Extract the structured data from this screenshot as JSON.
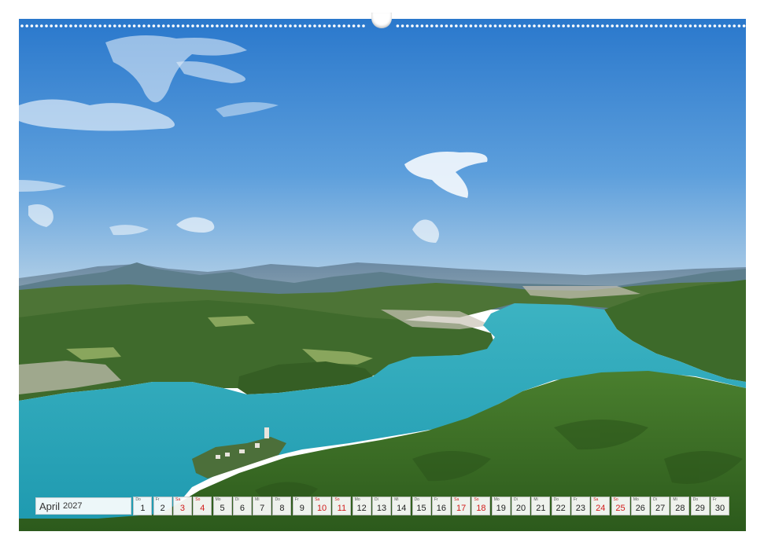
{
  "calendar": {
    "month": "April",
    "year": "2027",
    "days": [
      {
        "wd": "Do",
        "n": "1",
        "weekend": false
      },
      {
        "wd": "Fr",
        "n": "2",
        "weekend": false
      },
      {
        "wd": "Sa",
        "n": "3",
        "weekend": true
      },
      {
        "wd": "So",
        "n": "4",
        "weekend": true
      },
      {
        "wd": "Mo",
        "n": "5",
        "weekend": false
      },
      {
        "wd": "Di",
        "n": "6",
        "weekend": false
      },
      {
        "wd": "Mi",
        "n": "7",
        "weekend": false
      },
      {
        "wd": "Do",
        "n": "8",
        "weekend": false
      },
      {
        "wd": "Fr",
        "n": "9",
        "weekend": false
      },
      {
        "wd": "Sa",
        "n": "10",
        "weekend": true
      },
      {
        "wd": "So",
        "n": "11",
        "weekend": true
      },
      {
        "wd": "Mo",
        "n": "12",
        "weekend": false
      },
      {
        "wd": "Di",
        "n": "13",
        "weekend": false
      },
      {
        "wd": "Mi",
        "n": "14",
        "weekend": false
      },
      {
        "wd": "Do",
        "n": "15",
        "weekend": false
      },
      {
        "wd": "Fr",
        "n": "16",
        "weekend": false
      },
      {
        "wd": "Sa",
        "n": "17",
        "weekend": true
      },
      {
        "wd": "So",
        "n": "18",
        "weekend": true
      },
      {
        "wd": "Mo",
        "n": "19",
        "weekend": false
      },
      {
        "wd": "Di",
        "n": "20",
        "weekend": false
      },
      {
        "wd": "Mi",
        "n": "21",
        "weekend": false
      },
      {
        "wd": "Do",
        "n": "22",
        "weekend": false
      },
      {
        "wd": "Fr",
        "n": "23",
        "weekend": false
      },
      {
        "wd": "Sa",
        "n": "24",
        "weekend": true
      },
      {
        "wd": "So",
        "n": "25",
        "weekend": true
      },
      {
        "wd": "Mo",
        "n": "26",
        "weekend": false
      },
      {
        "wd": "Di",
        "n": "27",
        "weekend": false
      },
      {
        "wd": "Mi",
        "n": "28",
        "weekend": false
      },
      {
        "wd": "Do",
        "n": "29",
        "weekend": false
      },
      {
        "wd": "Fr",
        "n": "30",
        "weekend": false
      }
    ]
  },
  "colors": {
    "weekend": "#d21b1b",
    "sky_top": "#2f7fd0",
    "lake": "#2aa3b4",
    "forest": "#3b6b26"
  }
}
